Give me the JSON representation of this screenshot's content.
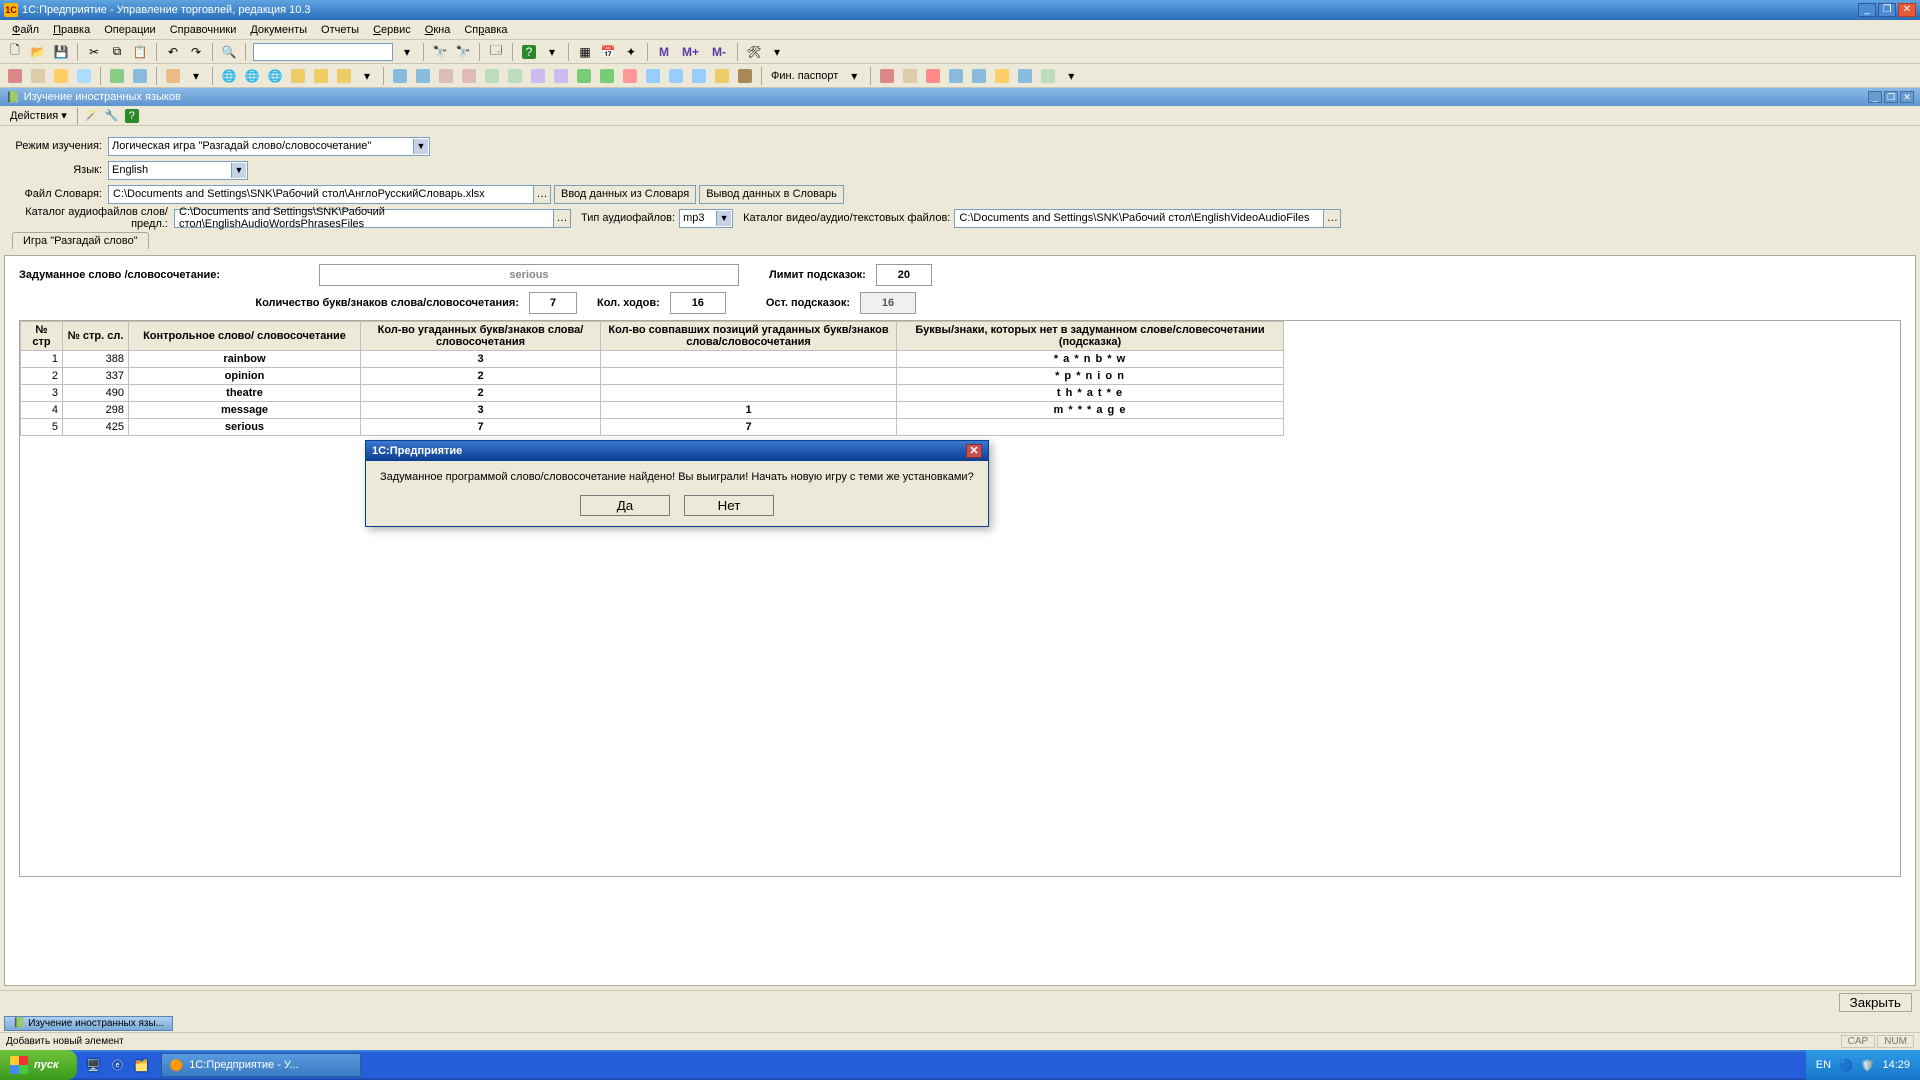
{
  "titlebar": {
    "title": "1С:Предприятие - Управление торговлей, редакция 10.3"
  },
  "menu": [
    "Файл",
    "Правка",
    "Операции",
    "Справочники",
    "Документы",
    "Отчеты",
    "Сервис",
    "Окна",
    "Справка"
  ],
  "toolbar1": {
    "search_value": "",
    "m_buttons": [
      "M",
      "M+",
      "M-"
    ]
  },
  "toolbar2": {
    "fin_label": "Фин. паспорт"
  },
  "subwin": {
    "title": "Изучение иностранных языков",
    "actions_label": "Действия"
  },
  "form": {
    "mode_label": "Режим изучения:",
    "mode_value": "Логическая игра \"Разгадай слово/словосочетание\"",
    "lang_label": "Язык:",
    "lang_value": "English",
    "dict_label": "Файл Словаря:",
    "dict_value": "C:\\Documents and Settings\\SNK\\Рабочий стол\\АнглоРусскийСловарь.xlsx",
    "btn_import": "Ввод данных из Словаря",
    "btn_export": "Вывод данных в Словарь",
    "audio_cat_label": "Каталог аудиофайлов слов/предл.:",
    "audio_cat_value": "C:\\Documents and Settings\\SNK\\Рабочий стол\\EnglishAudioWordsPhrasesFiles",
    "audio_type_label": "Тип аудиофайлов:",
    "audio_type_value": "mp3",
    "media_cat_label": "Каталог видео/аудио/текстовых файлов:",
    "media_cat_value": "C:\\Documents and Settings\\SNK\\Рабочий стол\\EnglishVideoAudioFiles",
    "tab_label": "Игра \"Разгадай слово\""
  },
  "game": {
    "guess_label": "Задуманное слово /словосочетание:",
    "guess_value": "serious",
    "hint_limit_label": "Лимит подсказок:",
    "hint_limit_value": "20",
    "letters_label": "Количество букв/знаков слова/словосочетания:",
    "letters_value": "7",
    "moves_label": "Кол. ходов:",
    "moves_value": "16",
    "hints_left_label": "Ост. подсказок:",
    "hints_left_value": "16"
  },
  "table": {
    "headers": [
      "№ стр",
      "№ стр. сл.",
      "Контрольное слово/ словосочетание",
      "Кол-во угаданных букв/знаков слова/словосочетания",
      "Кол-во совпавших позиций угаданных букв/знаков слова/словосочетания",
      "Буквы/знаки, которых нет в задуманном слове/словесочетании (подсказка)"
    ],
    "rows": [
      {
        "n": "1",
        "p": "388",
        "word": "rainbow",
        "g": "3",
        "m": "",
        "hint": "* a * n b * w"
      },
      {
        "n": "2",
        "p": "337",
        "word": "opinion",
        "g": "2",
        "m": "",
        "hint": "* p * n i o n"
      },
      {
        "n": "3",
        "p": "490",
        "word": "theatre",
        "g": "2",
        "m": "",
        "hint": "t h * a t * e"
      },
      {
        "n": "4",
        "p": "298",
        "word": "message",
        "g": "3",
        "m": "1",
        "hint": "m * * * a g e"
      },
      {
        "n": "5",
        "p": "425",
        "word": "serious",
        "g": "7",
        "m": "7",
        "hint": ""
      }
    ]
  },
  "modal": {
    "title": "1С:Предприятие",
    "text": "Задуманное программой слово/словосочетание найдено! Вы выиграли! Начать новую игру с теми же установками?",
    "yes": "Да",
    "no": "Нет"
  },
  "footer": {
    "close": "Закрыть",
    "task_tab": "Изучение иностранных язы...",
    "status_hint": "Добавить новый элемент",
    "cap": "CAP",
    "num": "NUM"
  },
  "taskbar": {
    "start": "пуск",
    "app": "1С:Предприятие - У...",
    "lang": "EN",
    "time": "14:29"
  }
}
